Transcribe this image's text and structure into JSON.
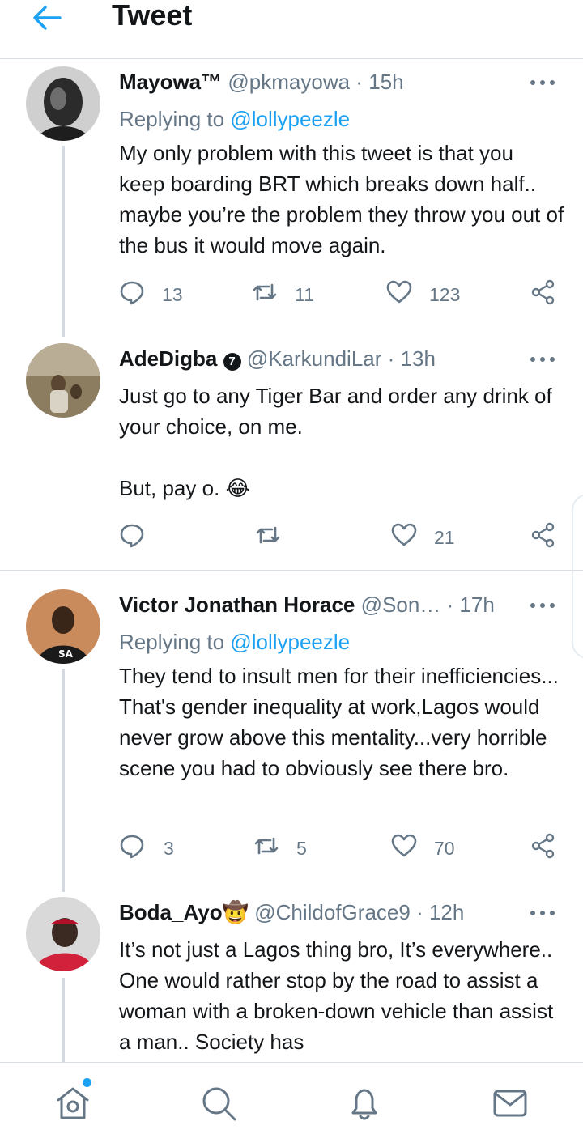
{
  "header": {
    "title": "Tweet"
  },
  "tweets": [
    {
      "name": "Mayowa™",
      "badge": "",
      "handle": "@pkmayowa",
      "sep": "·",
      "time": "15h",
      "replying_prefix": "Replying to",
      "replying_to": "@lollypeezle",
      "text": "My only problem with this tweet is that you keep boarding BRT which breaks down half.. maybe you’re the problem they throw you out of the bus it would move again.",
      "replies": "13",
      "retweets": "11",
      "likes": "123"
    },
    {
      "name": "AdeDigba",
      "badge": "7",
      "handle": "@KarkundiLar",
      "sep": "·",
      "time": "13h",
      "text1": "Just go to any Tiger Bar and order any drink of your choice, on me.",
      "text2": "But, pay o.",
      "emoji": "😂",
      "likes": "21"
    },
    {
      "name": "Victor Jonathan Horace",
      "handle": "@Son…",
      "sep": "·",
      "time": "17h",
      "replying_prefix": "Replying to",
      "replying_to": "@lollypeezle",
      "text": "They tend to insult men for their inefficiencies... That's gender inequality at work,Lagos would never grow above this mentality...very horrible scene you had to obviously see there bro.",
      "replies": "3",
      "retweets": "5",
      "likes": "70"
    },
    {
      "name": "Boda_Ayo",
      "emoji": "🤠",
      "handle": "@ChildofGrace9",
      "sep": "·",
      "time": "12h",
      "text": "It’s not just a Lagos thing bro, It’s everywhere.. One would rather stop by the road to assist a woman with a broken-down vehicle than assist a man.. Society has"
    }
  ],
  "icons": {
    "back": "arrow-left-icon",
    "more": "more-dots-icon",
    "reply": "reply-icon",
    "retweet": "retweet-icon",
    "like": "heart-icon",
    "share": "share-icon",
    "home": "home-icon",
    "search": "search-icon",
    "notifications": "bell-icon",
    "messages": "mail-icon"
  },
  "colors": {
    "accent": "#1da1f2",
    "secondary_text": "#657786",
    "primary_text": "#14171a"
  }
}
